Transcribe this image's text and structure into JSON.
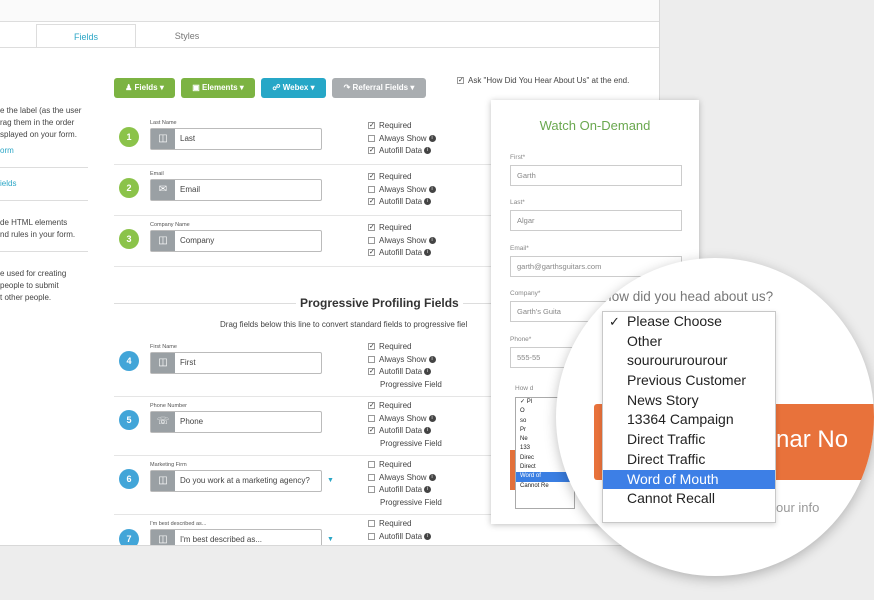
{
  "tabs": [
    {
      "label": "Fields"
    },
    {
      "label": "Styles"
    }
  ],
  "sidebar": {
    "para1": [
      "e the label (as the user",
      "rag them in the order",
      "splayed on your form."
    ],
    "link1": "orm",
    "link2": "ields",
    "para2": [
      "de HTML elements",
      "nd rules in your form."
    ],
    "para3": [
      "e used for creating",
      "people to submit",
      "t other people."
    ]
  },
  "toolbar": {
    "fields": "Fields",
    "elements": "Elements",
    "webex": "Webex",
    "referral": "Referral Fields",
    "ask": "Ask \"How Did You Hear About Us\" at the end."
  },
  "options": {
    "required": "Required",
    "always_show": "Always Show",
    "autofill": "Autofill Data",
    "progressive": "Progressive Field"
  },
  "fields": [
    {
      "num": "1",
      "label": "Last Name",
      "value": "Last"
    },
    {
      "num": "2",
      "label": "Email",
      "value": "Email"
    },
    {
      "num": "3",
      "label": "Company Name",
      "value": "Company"
    }
  ],
  "progressive": {
    "title": "Progressive Profiling Fields",
    "subtitle": "Drag fields below this line to convert standard fields to progressive fiel",
    "fields": [
      {
        "num": "4",
        "label": "First Name",
        "value": "First"
      },
      {
        "num": "5",
        "label": "Phone Number",
        "value": "Phone"
      },
      {
        "num": "6",
        "label": "Marketing Firm",
        "value": "Do you work at a marketing agency?"
      },
      {
        "num": "7",
        "label": "I'm best described as...",
        "value": "I'm best described as..."
      }
    ]
  },
  "preview": {
    "title": "Watch On-Demand",
    "first_label": "First*",
    "first_value": "Garth",
    "last_label": "Last*",
    "last_value": "Algar",
    "email_label": "Email*",
    "email_value": "garth@garthsguitars.com",
    "company_label": "Company*",
    "company_value": "Garth's Guita",
    "phone_label": "Phone*",
    "phone_value": "555-55",
    "how_label": "How d",
    "mini_options": [
      "Pl",
      "O",
      "so",
      "Pr",
      "Ne",
      "133",
      "Direc",
      "Direct",
      "Word of",
      "Cannot Re"
    ]
  },
  "magnifier": {
    "question": "How did you head about us?",
    "button_text": "nar No",
    "under_text": "our info",
    "options": [
      "Please Choose",
      "Other",
      "souroururourour",
      "Previous Customer",
      "News Story",
      "13364 Campaign",
      "Direct Traffic",
      "Direct Traffic",
      "Word of Mouth",
      "Cannot Recall"
    ],
    "checked_index": 0,
    "selected_index": 8
  },
  "colors": {
    "accent": "#2ba6c6",
    "green": "#7cb342",
    "orange": "#e8723b",
    "highlight": "#3d7fe6"
  }
}
